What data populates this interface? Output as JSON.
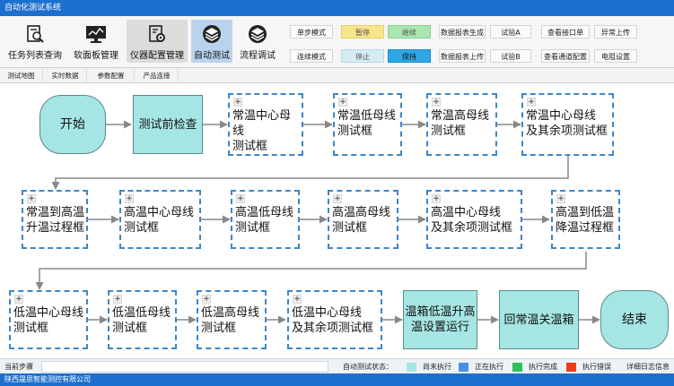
{
  "window": {
    "title": "自动化测试系统"
  },
  "ribbon": {
    "nav": [
      {
        "label": "任务列表查询",
        "icon": "magnifier-document-icon"
      },
      {
        "label": "软面板管理",
        "icon": "monitor-chart-icon"
      },
      {
        "label": "仪器配置管理",
        "icon": "settings-document-icon"
      },
      {
        "label": "自动测试",
        "icon": "layers-icon"
      },
      {
        "label": "流程调试",
        "icon": "layers-icon"
      }
    ],
    "buttons": {
      "single_step": "单步模式",
      "continuous": "连续模式",
      "pause": "暂停",
      "resume": "继续",
      "stop": "停止",
      "keep": "保持",
      "report_gen": "数据报表生成",
      "report_upload": "数据报表上传",
      "test_a": "试验A",
      "test_b": "试验B",
      "view_interface": "查看接口单",
      "view_channel": "查看通道配置",
      "abnormal_upload": "异常上传",
      "resistance": "电阻设置"
    },
    "colors": {
      "pause": "#f8e48a",
      "resume": "#a9e6b0",
      "stop": "#d6ecf5",
      "keep": "#2fa7e6"
    }
  },
  "tabs": [
    "测试地图",
    "实时数据",
    "参数配置",
    "产品连接"
  ],
  "flow": {
    "nodes": [
      {
        "text": "开始",
        "kind": "terminal"
      },
      {
        "text": "测试前检查",
        "kind": "step"
      },
      {
        "text": "常温中心母线\n测试框",
        "kind": "group"
      },
      {
        "text": "常温低母线\n测试框",
        "kind": "group"
      },
      {
        "text": "常温高母线\n测试框",
        "kind": "group"
      },
      {
        "text": "常温中心母线\n及其余项测试框",
        "kind": "group"
      },
      {
        "text": "常温到高温\n升温过程框",
        "kind": "group"
      },
      {
        "text": "高温中心母线\n测试框",
        "kind": "group"
      },
      {
        "text": "高温低母线\n测试框",
        "kind": "group"
      },
      {
        "text": "高温高母线\n测试框",
        "kind": "group"
      },
      {
        "text": "高温中心母线\n及其余项测试框",
        "kind": "group"
      },
      {
        "text": "高温到低温\n降温过程框",
        "kind": "group"
      },
      {
        "text": "低温中心母线\n测试框",
        "kind": "group"
      },
      {
        "text": "低温低母线\n测试框",
        "kind": "group"
      },
      {
        "text": "低温高母线\n测试框",
        "kind": "group"
      },
      {
        "text": "低温中心母线\n及其余项测试框",
        "kind": "group"
      },
      {
        "text": "温箱低温升高\n温设置运行",
        "kind": "step"
      },
      {
        "text": "回常温关温箱",
        "kind": "step"
      },
      {
        "text": "结束",
        "kind": "terminal"
      }
    ],
    "expand_symbol": "+",
    "colors": {
      "step_fill": "#a5e6e4",
      "group_border": "#3b87c8"
    }
  },
  "status": {
    "current_step_label": "当前步骤",
    "auto_state_label": "自动测试状态：",
    "legend": [
      {
        "label": "尚未执行",
        "color": "#a5e6e4"
      },
      {
        "label": "正在执行",
        "color": "#4a90e2"
      },
      {
        "label": "执行完成",
        "color": "#2ec05a"
      },
      {
        "label": "执行错误",
        "color": "#ee3b1c"
      }
    ],
    "log_link": "详细日志信息"
  },
  "footer": {
    "company": "陕西晟思智能测控有限公司"
  }
}
